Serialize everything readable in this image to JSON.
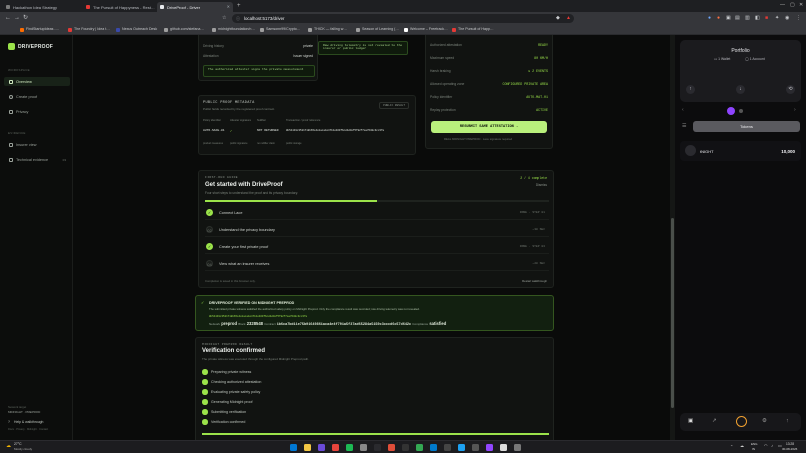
{
  "browser": {
    "tabs": [
      {
        "label": "Hackathon Idea Strategy",
        "color": "#7c7c7c"
      },
      {
        "label": "The Pursuit of Happyness - Rest…",
        "color": "#e53935"
      },
      {
        "label": "DriveProof - Driver",
        "color": "#e8eaed"
      }
    ],
    "address": "localhost:5173/driver",
    "bookmarks": [
      {
        "label": "FindStartupIdeas -…",
        "color": "#ff6d00"
      },
      {
        "label": "The Foundry | Idea t…",
        "color": "#e53935"
      },
      {
        "label": "Nexus Outreach Desk",
        "color": "#3949ab"
      },
      {
        "label": "github.com/stefana…",
        "color": "#9e9e9e"
      },
      {
        "label": "midnightfoundation/n…",
        "color": "#9e9e9e"
      },
      {
        "label": "Samsonn99/Crypto…",
        "color": "#9e9e9e"
      },
      {
        "label": "THICK — falling w…",
        "color": "#9e9e9e"
      },
      {
        "label": "Season of Learning (…",
        "color": "#9e9e9e"
      },
      {
        "label": "Welcome – Freetrack…",
        "color": "#ffffff"
      },
      {
        "label": "The Pursuit of Happ…",
        "color": "#e53935"
      }
    ]
  },
  "sidebar": {
    "brand": "DRIVEPROOF",
    "section_workspace": "WORKSPACE",
    "items": [
      "Overview",
      "Create proof",
      "Privacy"
    ],
    "section_evidence": "EVIDENCE",
    "items2": [
      "Insurer view",
      "Technical evidence"
    ],
    "badge": "03",
    "footer_network_label": "Network target",
    "footer_network": "MIDNIGHT · PREPROD",
    "footer_help": "Help & walkthrough",
    "footer_links": "Docs · Privacy · Midnight · Contact"
  },
  "top_left_card": {
    "rows": [
      {
        "label": "Driving history",
        "value": "private"
      },
      {
        "label": "Attestation",
        "value": "Issuer signed"
      }
    ],
    "note": "The authorized attester signs the private measurement"
  },
  "top_mid_card": {
    "note": "Raw driving telemetry is not revealed to the insurer or public ledger"
  },
  "top_right_card": {
    "rows": [
      {
        "label": "Authorized attestation",
        "value": "READY"
      },
      {
        "label": "Maximum speed",
        "value": "80 KM/H"
      },
      {
        "label": "Harsh braking",
        "value": "≤ 2 EVENTS"
      },
      {
        "label": "Allowed operating zone",
        "value": "CONFIGURED PRIVATE AREA"
      },
      {
        "label": "Policy identifier",
        "value": "AUTO-MAT-01"
      },
      {
        "label": "Replay protection",
        "value": "ACTIVE"
      }
    ],
    "button": "RESUBMIT SAME ATTESTATION →",
    "footnote": "REAL MIDNIGHT PREPROD · Lace signature required"
  },
  "metadata": {
    "title": "PUBLIC PROOF METADATA",
    "subtitle": "Public fields recorded by the registered proof contract.",
    "chip": "PUBLIC RESULT",
    "columns": [
      "Policy identifier",
      "Attester signature",
      "Nullifier",
      "Transaction / proof reference"
    ],
    "values": [
      "AUTO-SAFE-01",
      "✓",
      "NOT RETURNED",
      "0b54449c3521718b65e4e1aca4e47b1eb69f6cd4d3ef5f82f7ea7640c3cc3fa"
    ],
    "subvalues": [
      "product measures",
      "public signature",
      "no nullifier claim",
      "public storage"
    ]
  },
  "first_run": {
    "title_small": "FIRST-RUN GUIDE",
    "title": "Get started with DriveProof",
    "subtitle": "Four short steps to understand the proof and its privacy boundary.",
    "progress_text": "2 / 4 complete",
    "dismiss": "Dismiss",
    "progress": 0.5,
    "steps": [
      {
        "label": "Connect Lace",
        "done": true,
        "meta": "DONE · STEP 01"
      },
      {
        "label": "Understand the privacy boundary",
        "done": false,
        "meta": "~30 SEC"
      },
      {
        "label": "Create your first private proof",
        "done": true,
        "meta": "DONE · STEP 03"
      },
      {
        "label": "View what an insurer receives",
        "done": false,
        "meta": "~20 SEC"
      }
    ],
    "footer_left": "Completion is saved in this browser only.",
    "footer_right": "Restart walkthrough"
  },
  "verified": {
    "title": "DRIVEPROOF VERIFIED ON MIDNIGHT PREPROD",
    "text": "The submitted private witness satisfied the authorized safety policy on Midnight Preprod. Only the compliance result was recorded; raw driving telemetry was not revealed.",
    "hash": "0b54449c3521718b65e4e1aca4e47b1eb69f6cd4d3ef5f82f7ea7640c3cc3fa",
    "network_label": "Network",
    "network": "preprod",
    "block_label": "Block",
    "block": "2328548",
    "contract_label": "Contract",
    "contract": "1b6ca7bd11e75b01649861aca4e4f701a5f37ad65284a5150c3cccd6c57d642c",
    "compliance_label": "Compliance",
    "compliance": "satisfied"
  },
  "result": {
    "title_small": "MIDNIGHT PREPROD RESULT",
    "title": "Verification confirmed",
    "subtitle": "The private witness was executed through the configured Midnight Preprod path.",
    "items": [
      "Preparing private witness",
      "Checking authorized attestation",
      "Evaluating private safety policy",
      "Generating Midnight proof",
      "Submitting verification",
      "Verification confirmed"
    ],
    "progress": 1.0
  },
  "wallet": {
    "title": "Portfolio",
    "wallet_count": "1 Wallet",
    "account_count": "1 Account",
    "tab": "Tokens",
    "token_name": "tNIGHT",
    "token_amount": "10,000"
  },
  "taskbar": {
    "weather_temp": "27°C",
    "weather_desc": "Mostly cloudy",
    "lang": "ENG",
    "region": "IN",
    "time": "13:28",
    "date": "30-08-2026"
  },
  "colors": {
    "accent": "#9be34a",
    "bg": "#0a0b0a",
    "card": "#111311"
  }
}
